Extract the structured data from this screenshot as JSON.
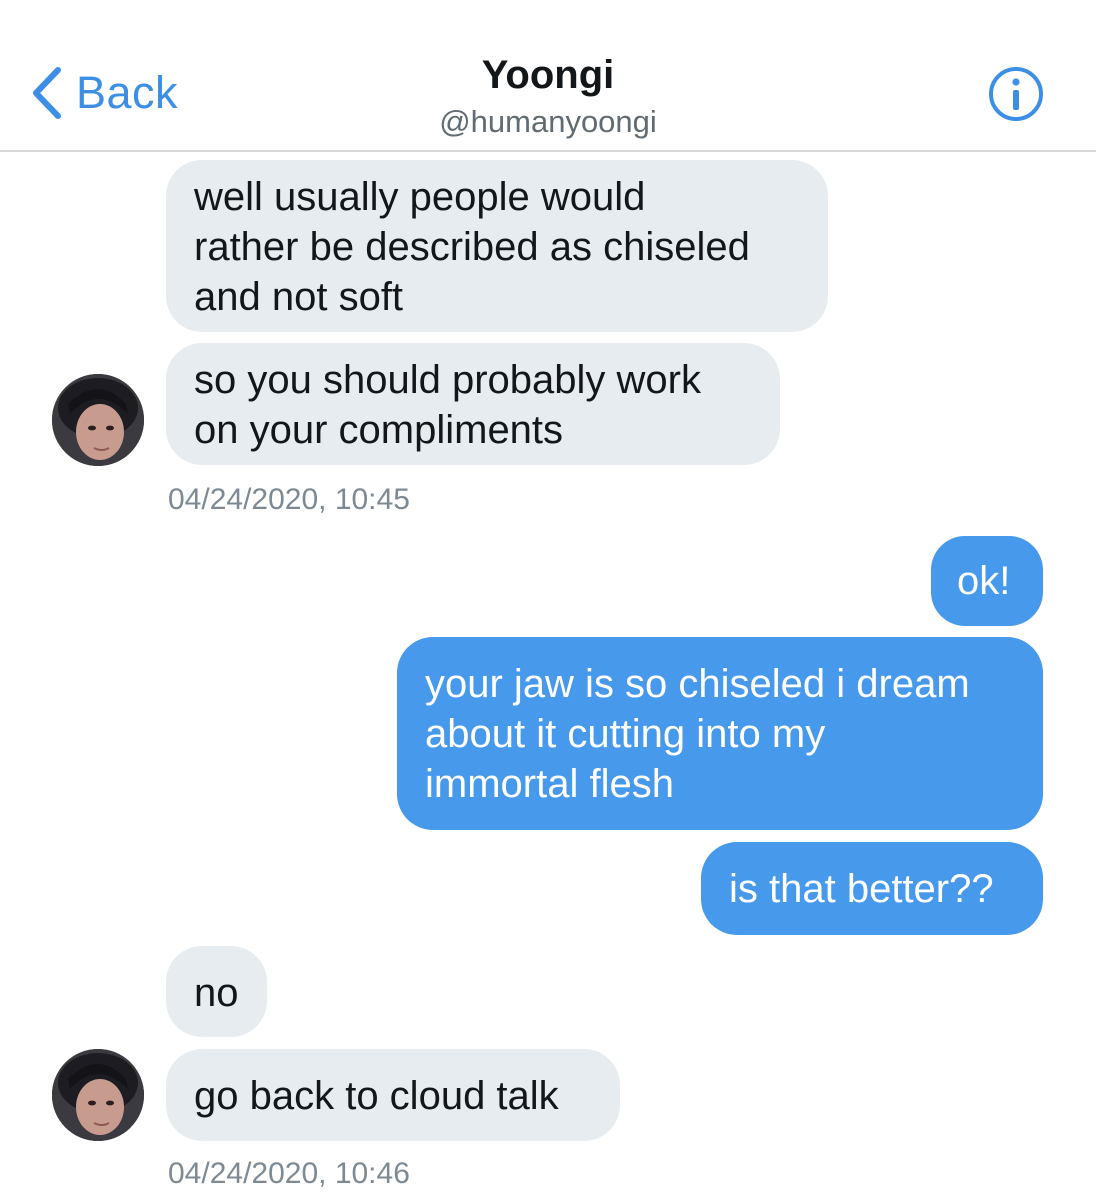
{
  "header": {
    "back_label": "Back",
    "title": "Yoongi",
    "handle": "@humanyoongi",
    "accent_color": "#3d8fe6",
    "icons": [
      "chevron-left-icon",
      "info-icon"
    ]
  },
  "messages": [
    {
      "side": "in",
      "text": "well usually people would\nrather be described as chiseled\nand not soft"
    },
    {
      "side": "in",
      "text": "so you should probably work\non your compliments"
    },
    {
      "side": "in",
      "timestamp": "04/24/2020, 10:45"
    },
    {
      "side": "out",
      "text": "ok!"
    },
    {
      "side": "out",
      "text": "your jaw is so chiseled i dream\nabout it cutting into my\nimmortal flesh"
    },
    {
      "side": "out",
      "text": "is that better??"
    },
    {
      "side": "in",
      "text": "no"
    },
    {
      "side": "in",
      "text": "go back to cloud talk"
    },
    {
      "side": "in",
      "timestamp": "04/24/2020, 10:46"
    }
  ],
  "colors": {
    "incoming_bubble": "#e6ecf0",
    "outgoing_bubble": "#4799eb",
    "timestamp": "#7d8a94"
  }
}
